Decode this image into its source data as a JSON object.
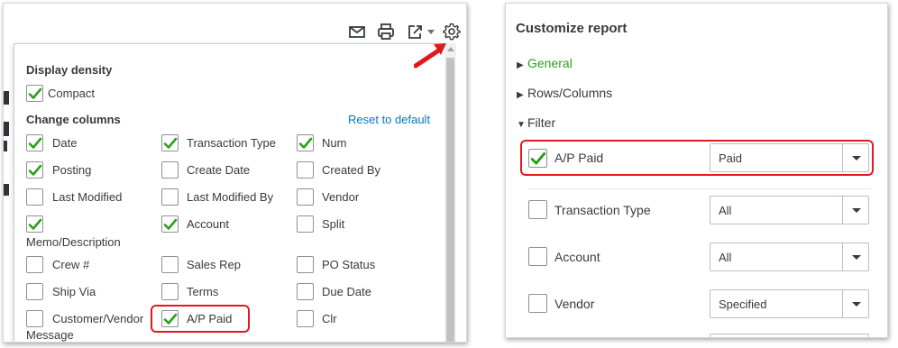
{
  "toolbar": {
    "icons": [
      "email-icon",
      "print-icon",
      "export-icon",
      "settings-gear-icon"
    ]
  },
  "columns_dropdown": {
    "display_density_label": "Display density",
    "compact_label": "Compact",
    "change_columns_label": "Change columns",
    "reset_link": "Reset to default",
    "options": [
      {
        "label": "Date",
        "checked": true
      },
      {
        "label": "Transaction Type",
        "checked": true
      },
      {
        "label": "Num",
        "checked": true
      },
      {
        "label": "Posting",
        "checked": true
      },
      {
        "label": "Create Date",
        "checked": false
      },
      {
        "label": "Created By",
        "checked": false
      },
      {
        "label": "Last Modified",
        "checked": false
      },
      {
        "label": "Last Modified By",
        "checked": false
      },
      {
        "label": "Vendor",
        "checked": false
      },
      {
        "label": "Memo/Description",
        "checked": true
      },
      {
        "label": "Account",
        "checked": true
      },
      {
        "label": "Split",
        "checked": false
      },
      {
        "label": "Crew #",
        "checked": false
      },
      {
        "label": "Sales Rep",
        "checked": false
      },
      {
        "label": "PO Status",
        "checked": false
      },
      {
        "label": "Ship Via",
        "checked": false
      },
      {
        "label": "Terms",
        "checked": false
      },
      {
        "label": "Due Date",
        "checked": false
      },
      {
        "label": "Customer/Vendor",
        "label_line2": "Message",
        "checked": false
      },
      {
        "label": "A/P Paid",
        "checked": true
      },
      {
        "label": "Clr",
        "checked": false
      }
    ]
  },
  "customize_report": {
    "title": "Customize report",
    "sections": {
      "general": "General",
      "rows_columns": "Rows/Columns",
      "filter": "Filter"
    },
    "filters": [
      {
        "label": "A/P Paid",
        "checked": true,
        "value": "Paid"
      },
      {
        "label": "Transaction Type",
        "checked": false,
        "value": "All"
      },
      {
        "label": "Account",
        "checked": false,
        "value": "All"
      },
      {
        "label": "Vendor",
        "checked": false,
        "value": "Specified"
      }
    ]
  },
  "colors": {
    "check_green": "#2ca01c",
    "highlight_red": "#e0191f",
    "link_blue": "#0077c5"
  }
}
